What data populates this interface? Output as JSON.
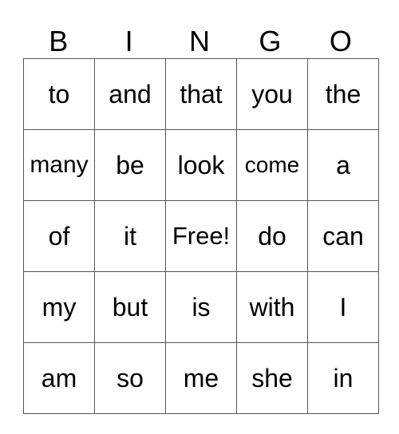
{
  "header": [
    "B",
    "I",
    "N",
    "G",
    "O"
  ],
  "rows": [
    [
      "to",
      "and",
      "that",
      "you",
      "the"
    ],
    [
      "many",
      "be",
      "look",
      "come",
      "a"
    ],
    [
      "of",
      "it",
      "Free!",
      "do",
      "can"
    ],
    [
      "my",
      "but",
      "is",
      "with",
      "I"
    ],
    [
      "am",
      "so",
      "me",
      "she",
      "in"
    ]
  ]
}
